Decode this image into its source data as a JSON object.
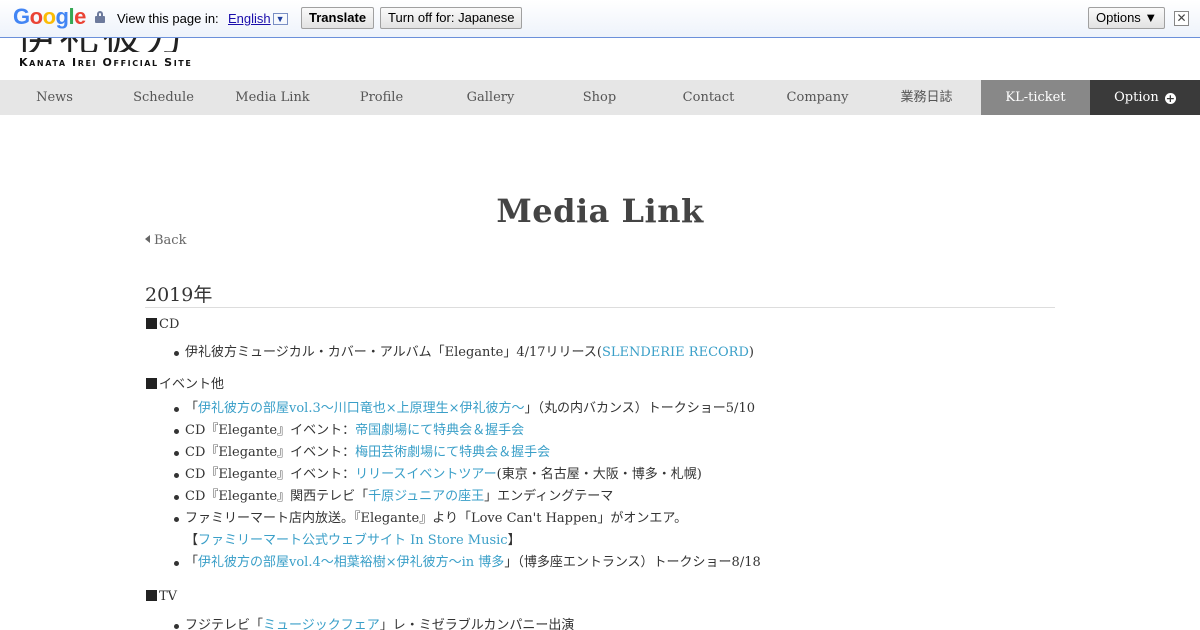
{
  "translate_bar": {
    "view_text": "View this page in:",
    "language": "English",
    "translate_label": "Translate",
    "turn_off_label": "Turn off for: Japanese",
    "options_label": "Options ▼",
    "close_label": "✕"
  },
  "header": {
    "logo_jp": "伊礼彼方",
    "logo_en": "Kanata Irei Official Site"
  },
  "nav": [
    "News",
    "Schedule",
    "Media Link",
    "Profile",
    "Gallery",
    "Shop",
    "Contact",
    "Company",
    "業務日誌",
    "KL-ticket",
    "Option"
  ],
  "main": {
    "title": "Media Link",
    "back_label": "Back",
    "year": "2019年",
    "sections": {
      "cd": {
        "heading": "CD",
        "items": [
          {
            "pre": "伊礼彼方ミュージカル・カバー・アルバム「Elegante」4/17リリース(",
            "link": "SLENDERIE RECORD",
            "post": ")"
          }
        ]
      },
      "events": {
        "heading": "イベント他",
        "items": [
          {
            "pre": "「",
            "link": "伊礼彼方の部屋vol.3～川口竜也×上原理生×伊礼彼方～",
            "post": "」（丸の内バカンス）トークショー5/10"
          },
          {
            "pre": "CD『Elegante』イベント：",
            "link": "帝国劇場にて特典会＆握手会",
            "post": ""
          },
          {
            "pre": "CD『Elegante』イベント：",
            "link": "梅田芸術劇場にて特典会＆握手会",
            "post": ""
          },
          {
            "pre": "CD『Elegante』イベント：",
            "link": "リリースイベントツアー",
            "post": "(東京・名古屋・大阪・博多・札幌)"
          },
          {
            "pre": "CD『Elegante』関西テレビ「",
            "link": "千原ジュニアの座王",
            "post": "」エンディングテーマ"
          },
          {
            "pre": "ファミリーマート店内放送。『Elegante』より「Love Can't Happen」がオンエア。",
            "link": "",
            "post": ""
          },
          {
            "pre": "【",
            "link": "ファミリーマート公式ウェブサイト In Store Music",
            "post": "】"
          },
          {
            "pre": "「",
            "link": "伊礼彼方の部屋vol.4～相葉裕樹×伊礼彼方～in 博多",
            "post": "」（博多座エントランス）トークショー8/18"
          }
        ]
      },
      "tv": {
        "heading": "TV",
        "items": [
          {
            "pre": "フジテレビ「",
            "link": "ミュージックフェア",
            "post": "」レ・ミゼラブルカンパニー出演"
          }
        ]
      }
    }
  }
}
